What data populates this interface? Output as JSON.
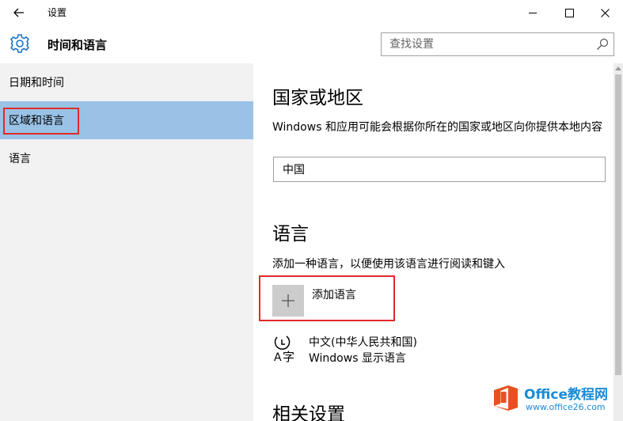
{
  "window": {
    "title": "设置",
    "icons": {
      "back": "back-arrow-icon",
      "minimize": "minimize-icon",
      "maximize": "maximize-icon",
      "close": "close-icon"
    }
  },
  "header": {
    "title": "时间和语言",
    "icon": "gear-icon",
    "search_placeholder": "查找设置",
    "search_icon": "search-icon"
  },
  "sidebar": {
    "items": [
      {
        "label": "日期和时间",
        "selected": false
      },
      {
        "label": "区域和语言",
        "selected": true
      },
      {
        "label": "语言",
        "selected": false
      }
    ],
    "selected_color": "#99c2e6"
  },
  "main": {
    "region_heading": "国家或地区",
    "region_desc": "Windows 和应用可能会根据你所在的国家或地区向你提供本地内容",
    "region_value": "中国",
    "language_heading": "语言",
    "language_desc": "添加一种语言，以便使用该语言进行阅读和键入",
    "add_language_label": "添加语言",
    "add_icon": "plus-icon",
    "installed_language": {
      "name": "中文(中华人民共和国)",
      "subtitle": "Windows 显示语言",
      "icon": "language-icon"
    },
    "related_heading": "相关设置"
  },
  "highlight_color": "#e02a2a",
  "watermark": {
    "title": "Office教程网",
    "url": "www.office26.com",
    "icon": "office-logo-icon"
  }
}
